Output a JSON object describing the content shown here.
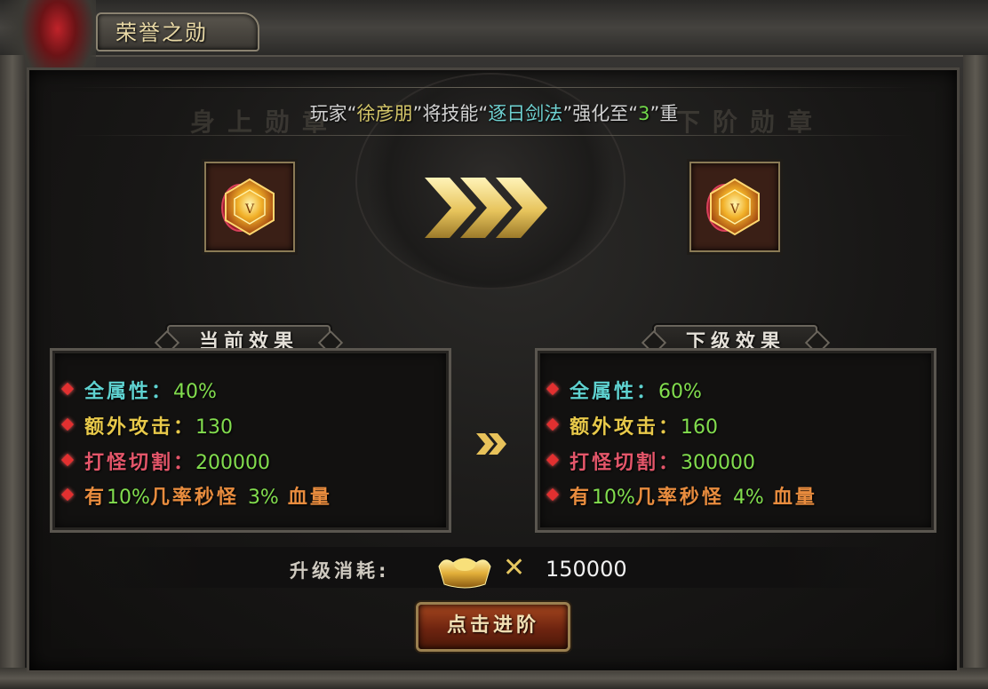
{
  "window": {
    "title": "荣誉之勋"
  },
  "announcement": {
    "prefix": "玩家“",
    "player": "徐彦朋",
    "mid1": "”将技能“",
    "skill": "逐日剑法",
    "mid2": "”强化至“",
    "level": "3",
    "suffix": "”重"
  },
  "current_item": {
    "icon": "honor-medal-icon",
    "caption": "身上勋章"
  },
  "next_item": {
    "icon": "honor-medal-icon",
    "caption": "下阶勋章"
  },
  "current_panel": {
    "title": "当前效果",
    "effects": [
      {
        "label": "全属性：",
        "value": "40%",
        "color": "#5fd2d0"
      },
      {
        "label": "额外攻击：",
        "value": "130",
        "color": "#e8c94a"
      },
      {
        "label": "打怪切割：",
        "value": "200000",
        "color": "#e4566a"
      },
      {
        "pre": "有",
        "chance": "10%",
        "mid": "几率秒怪",
        "pct": "3%",
        "post": "血量",
        "color": "#e88c3e"
      }
    ]
  },
  "next_panel": {
    "title": "下级效果",
    "effects": [
      {
        "label": "全属性：",
        "value": "60%",
        "color": "#5fd2d0"
      },
      {
        "label": "额外攻击：",
        "value": "160",
        "color": "#e8c94a"
      },
      {
        "label": "打怪切割：",
        "value": "300000",
        "color": "#e4566a"
      },
      {
        "pre": "有",
        "chance": "10%",
        "mid": "几率秒怪",
        "pct": "4%",
        "post": "血量",
        "color": "#e88c3e"
      }
    ]
  },
  "cost": {
    "label": "升级消耗:",
    "currency_icon": "gold-ingot-icon",
    "multiplier": "✕",
    "amount": "150000"
  },
  "advance_button": {
    "label": "点击进阶"
  },
  "colors": {
    "accent_gold": "#e8c94a",
    "button": "#8a3414",
    "value_green": "#82dd4e"
  }
}
